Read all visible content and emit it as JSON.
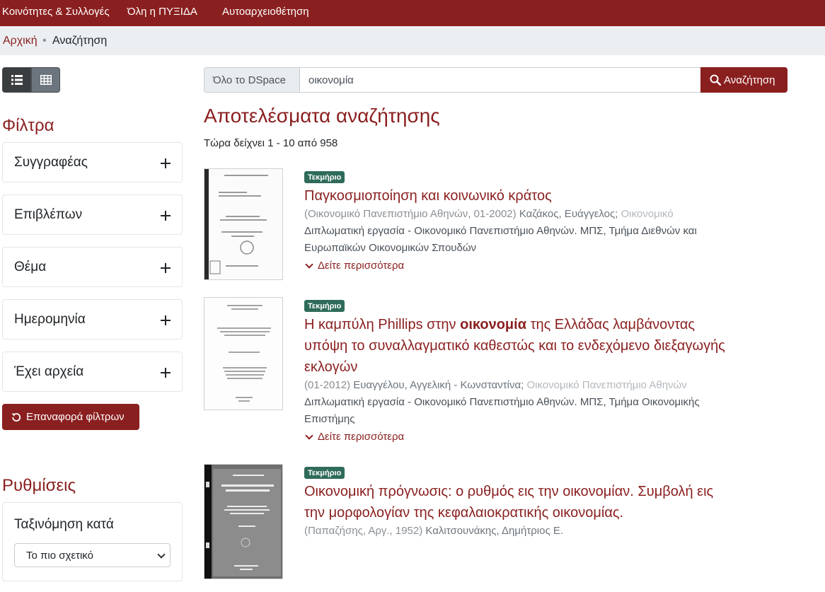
{
  "topnav": {
    "items": [
      "Κοινότητες & Συλλογές",
      "Όλη η ΠΥΞΙΔΑ",
      "Αυτοαρχειοθέτηση"
    ]
  },
  "breadcrumb": {
    "home": "Αρχική",
    "separator": "•",
    "current": "Αναζήτηση"
  },
  "sidebar": {
    "filters_heading": "Φίλτρα",
    "facets": [
      "Συγγραφέας",
      "Επιβλέπων",
      "Θέμα",
      "Ημερομηνία",
      "Έχει αρχεία"
    ],
    "reset_label": "Επαναφορά φίλτρων",
    "settings_heading": "Ρυθμίσεις",
    "sort_label": "Ταξινόμηση κατά",
    "sort_value": "Το πιο σχετικό"
  },
  "search": {
    "scope": "Όλο το DSpace",
    "query": "οικονομία",
    "button": "Αναζήτηση"
  },
  "results": {
    "heading": "Αποτελέσματα αναζήτησης",
    "showing": "Τώρα δείχνει 1 - 10 από 958",
    "items": [
      {
        "badge": "Τεκμήριο",
        "title_pre": "Παγκοσμιοποίηση και κοινωνικό κράτος",
        "title_hl": "",
        "title_post": "",
        "meta_pub": "(Οικονομικό Πανεπιστήμιο Αθηνών, 01-2002)",
        "meta_auth": "Καζάκος, Ευάγγελος;",
        "meta_more": "Οικονομικό",
        "abstract": "Διπλωματική εργασία - Οικονομικό Πανεπιστήμιο Αθηνών. ΜΠΣ, Τμήμα Διεθνών και Ευρωπαϊκών Οικονομικών Σπουδών",
        "more": "Δείτε περισσότερα"
      },
      {
        "badge": "Τεκμήριο",
        "title_pre": "Η καμπύλη Phillips στην ",
        "title_hl": "οικονομία",
        "title_post": " της Ελλάδας λαμβάνοντας υπόψη το συναλλαγματικό καθεστώς και το ενδεχόμενο διεξαγωγής εκλογών",
        "meta_pub": "(01-2012)",
        "meta_auth": "Ευαγγέλου, Αγγελική - Κωνσταντίνα;",
        "meta_more": "Οικονομικό Πανεπιστήμιο Αθηνών",
        "abstract": "Διπλωματική εργασία - Οικονομικό Πανεπιστήμιο Αθηνών. ΜΠΣ, Τμήμα Οικονομικής Επιστήμης",
        "more": "Δείτε περισσότερα"
      },
      {
        "badge": "Τεκμήριο",
        "title_pre": "Οικονομική πρόγνωσις: ο ρυθμός εις την οικονομίαν. Συμβολή εις την μορφολογίαν της κεφαλαιοκρατικής οικονομίας.",
        "title_hl": "",
        "title_post": "",
        "meta_pub": "(Παπαζήσης, Αργ., 1952)",
        "meta_auth": "Καλιτσουνάκης, Δημήτριος Ε.",
        "meta_more": ""
      }
    ]
  },
  "colors": {
    "brand": "#8a1f1f",
    "badge": "#2f6b5a",
    "crumbbar": "#eceff2"
  },
  "icons": [
    "list-icon",
    "grid-icon",
    "plus-icon",
    "undo-icon",
    "search-icon",
    "chevron-down-icon"
  ]
}
